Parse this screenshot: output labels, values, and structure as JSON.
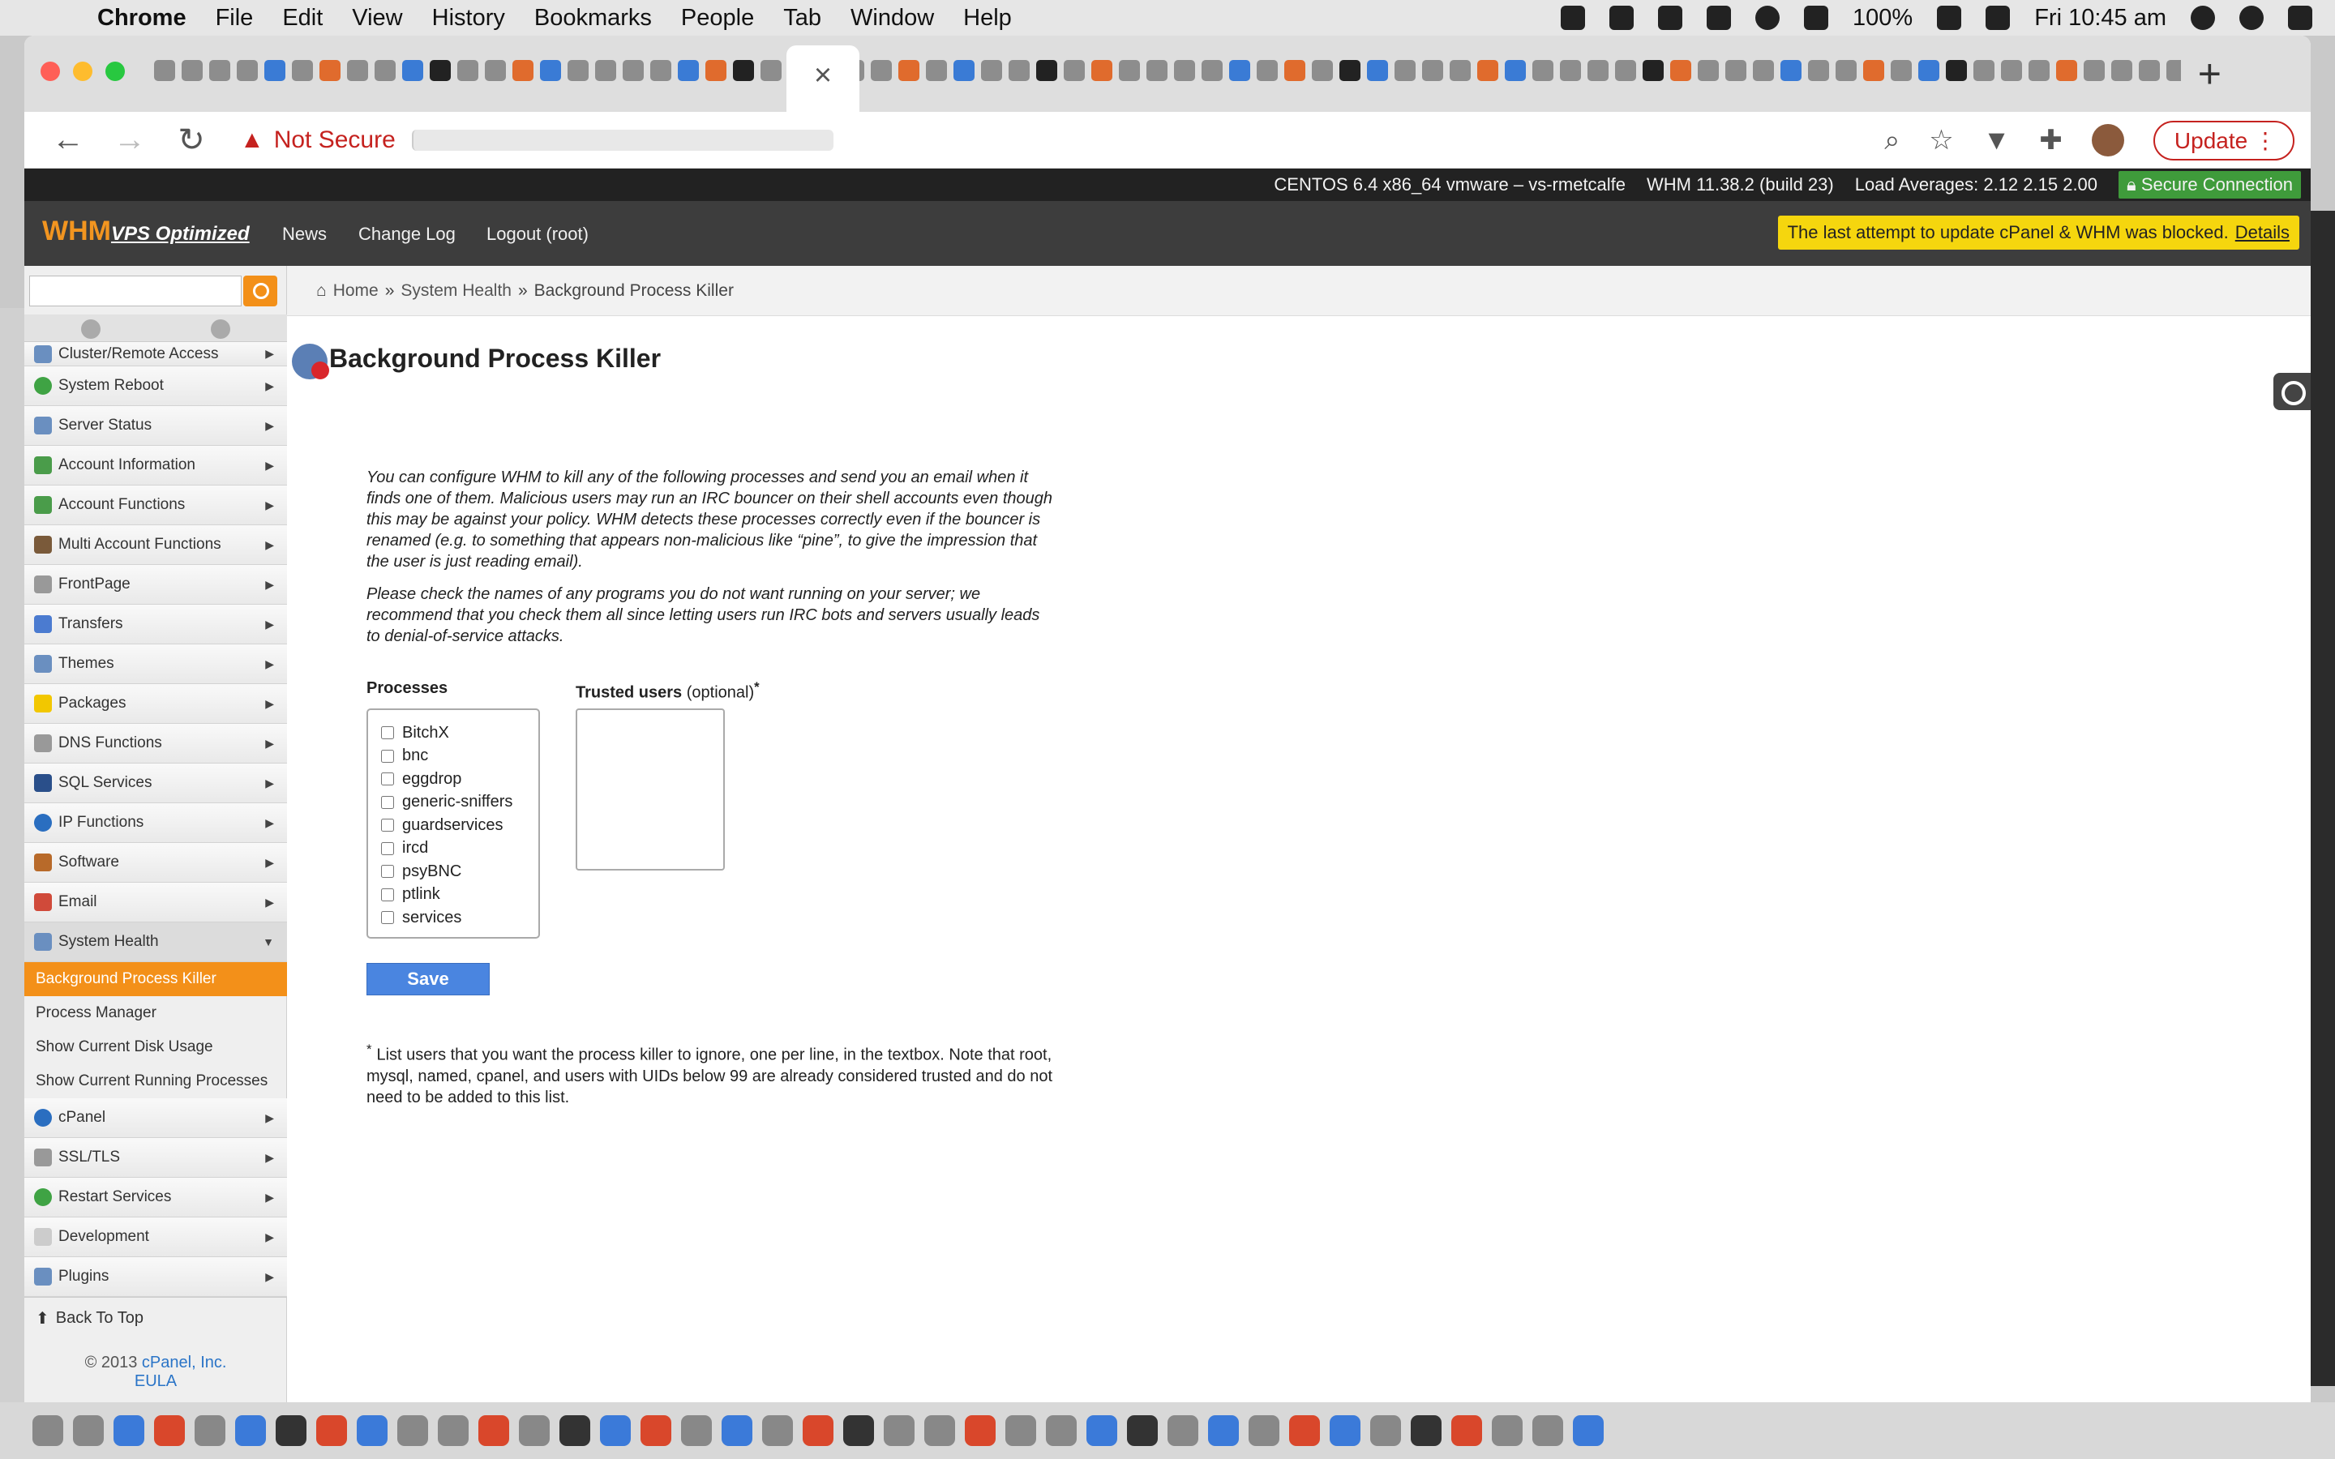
{
  "menubar": {
    "app": "Chrome",
    "items": [
      "File",
      "Edit",
      "View",
      "History",
      "Bookmarks",
      "People",
      "Tab",
      "Window",
      "Help"
    ],
    "battery": "100%",
    "clock": "Fri 10:45 am"
  },
  "browser": {
    "security_label": "Not Secure",
    "update_label": "Update",
    "tab_close": "×",
    "new_tab": "+"
  },
  "whm": {
    "server_info": "CENTOS 6.4 x86_64 vmware – vs-rmetcalfe",
    "version": "WHM 11.38.2 (build 23)",
    "load": "Load Averages: 2.12 2.15 2.00",
    "secure": "Secure Connection",
    "logo_main": "WHM",
    "logo_sub": "VPS Optimized",
    "nav": [
      "News",
      "Change Log",
      "Logout (root)"
    ],
    "alert_text": "The last attempt to update cPanel & WHM was blocked.",
    "alert_link": "Details"
  },
  "sidebar": {
    "items": [
      "Cluster/Remote Access",
      "System Reboot",
      "Server Status",
      "Account Information",
      "Account Functions",
      "Multi Account Functions",
      "FrontPage",
      "Transfers",
      "Themes",
      "Packages",
      "DNS Functions",
      "SQL Services",
      "IP Functions",
      "Software",
      "Email"
    ],
    "open_section": "System Health",
    "sub_items": [
      "Background Process Killer",
      "Process Manager",
      "Show Current Disk Usage",
      "Show Current Running Processes"
    ],
    "items_after": [
      "cPanel",
      "SSL/TLS",
      "Restart Services",
      "Development",
      "Plugins"
    ],
    "back_to_top": "Back To Top",
    "copyright": "© 2013",
    "copyright_link": "cPanel, Inc.",
    "eula": "EULA"
  },
  "breadcrumb": {
    "home": "Home",
    "sep": "»",
    "section": "System Health",
    "current": "Background Process Killer"
  },
  "page": {
    "title": "Background Process Killer",
    "para1": "You can configure WHM to kill any of the following processes and send you an email when it finds one of them. Malicious users may run an IRC bouncer on their shell accounts even though this may be against your policy. WHM detects these processes correctly even if the bouncer is renamed (e.g. to something that appears non-malicious like “pine”, to give the impression that the user is just reading email).",
    "para2": "Please check the names of any programs you do not want running on your server; we recommend that you check them all since letting users run IRC bots and servers usually leads to denial-of-service attacks.",
    "processes_label": "Processes",
    "trusted_label": "Trusted users",
    "trusted_optional": "(optional)",
    "trusted_mark": "*",
    "processes": [
      "BitchX",
      "bnc",
      "eggdrop",
      "generic-sniffers",
      "guardservices",
      "ircd",
      "psyBNC",
      "ptlink",
      "services"
    ],
    "save_label": "Save",
    "footnote": "List users that you want the process killer to ignore, one per line, in the textbox. Note that root, mysql, named, cpanel, and users with UIDs below 99 are already considered trusted and do not need to be added to this list."
  }
}
